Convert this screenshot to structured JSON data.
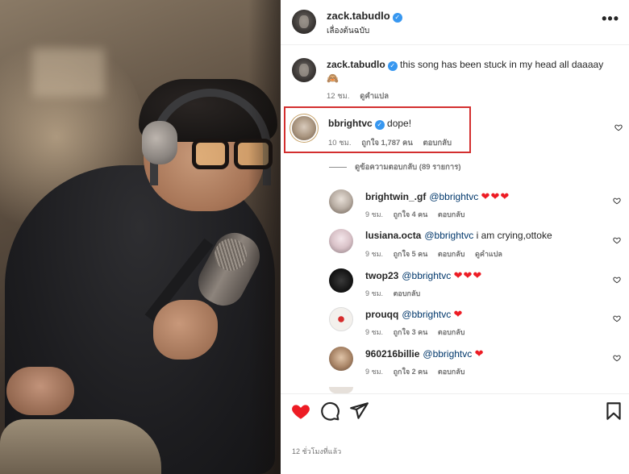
{
  "post": {
    "author": "zack.tabudlo",
    "location": "เลื่องต้นฉบับ",
    "caption_user": "zack.tabudlo",
    "caption_text": "this song has been stuck in my head all daaaay",
    "caption_emoji": "🙈",
    "caption_time": "12 ชม.",
    "caption_action": "ดูคำแปล",
    "more_icon": "•••"
  },
  "highlighted_comment": {
    "user": "bbrightvc",
    "text": "dope!",
    "time": "10 ชม.",
    "likes": "ถูกใจ 1,787 คน",
    "reply": "ตอบกลับ",
    "view_replies": "ดูข้อความตอบกลับ (89 รายการ)",
    "highlight_color": "#d32f2f"
  },
  "replies": [
    {
      "user": "brightwin_.gf",
      "mention": "@bbrightvc",
      "text": "",
      "hearts": "❤❤❤",
      "time": "9 ชม.",
      "likes": "ถูกใจ 4 คน",
      "action": "ตอบกลับ"
    },
    {
      "user": "lusiana.octa",
      "mention": "@bbrightvc",
      "text": "i am crying,ottoke",
      "hearts": "",
      "time": "9 ชม.",
      "likes": "ถูกใจ 5 คน",
      "action": "ตอบกลับ",
      "action2": "ดูคำแปล"
    },
    {
      "user": "twop23",
      "mention": "@bbrightvc",
      "text": "",
      "hearts": "❤❤❤",
      "time": "9 ชม.",
      "likes": "",
      "action": "ตอบกลับ"
    },
    {
      "user": "prouqq",
      "mention": "@bbrightvc",
      "text": "",
      "hearts": "❤",
      "time": "9 ชม.",
      "likes": "ถูกใจ 3 คน",
      "action": "ตอบกลับ"
    },
    {
      "user": "960216billie",
      "mention": "@bbrightvc",
      "text": "",
      "hearts": "❤",
      "time": "9 ชม.",
      "likes": "ถูกใจ 2 คน",
      "action": "ตอบกลับ"
    }
  ],
  "actions": {
    "like_icon": "heart-filled-icon",
    "comment_icon": "comment-icon",
    "share_icon": "send-icon",
    "save_icon": "bookmark-icon",
    "like_color": "#ed1c24"
  },
  "footer": {
    "time": "12 ชั่วโมงที่แล้ว"
  },
  "colors": {
    "verified": "#3797f0",
    "mention": "#00376b",
    "muted": "#737373"
  }
}
